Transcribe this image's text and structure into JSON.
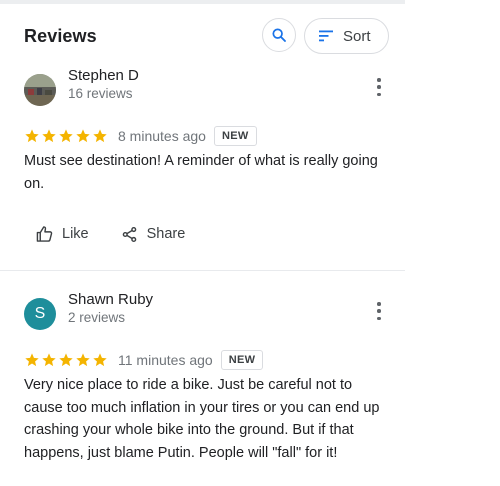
{
  "header": {
    "title": "Reviews",
    "sort_label": "Sort"
  },
  "reviews": [
    {
      "author": "Stephen D",
      "review_count": "16 reviews",
      "rating": 5,
      "time": "8 minutes ago",
      "badge": "NEW",
      "text": "Must see destination! A reminder of what is really going on.",
      "like_label": "Like",
      "share_label": "Share"
    },
    {
      "author": "Shawn Ruby",
      "avatar_letter": "S",
      "review_count": "2 reviews",
      "rating": 5,
      "time": "11 minutes ago",
      "badge": "NEW",
      "text": "Very nice place to ride a bike. Just be careful not to cause too much inflation in your tires or you can end up crashing your whole bike into the ground. But if that happens, just blame Putin. People will \"fall\" for it!"
    }
  ],
  "colors": {
    "star": "#f4b400",
    "avatar_bg": "#1e8e9b",
    "search_icon": "#1a73e8"
  }
}
